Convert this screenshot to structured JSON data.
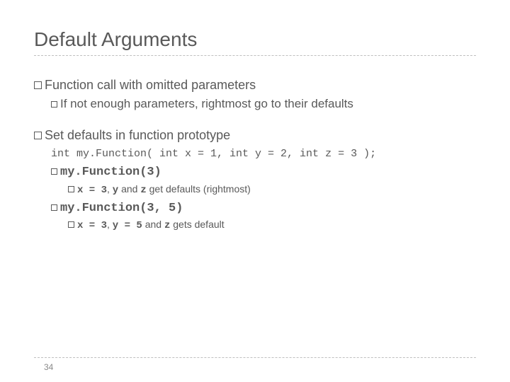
{
  "title": "Default Arguments",
  "bullet1": {
    "text": "Function call with omitted parameters",
    "sub": "If not enough parameters, rightmost go to their defaults"
  },
  "bullet2": {
    "text": "Set defaults in function prototype",
    "code": "int my.Function( int x = 1, int y = 2, int z = 3 );",
    "ex1": {
      "call": "my.Function(3)",
      "expl_pre": "x = 3",
      "expl_mid": ", ",
      "expl_y": "y",
      "expl_and": " and ",
      "expl_z": "z",
      "expl_tail": " get defaults (rightmost)"
    },
    "ex2": {
      "call": "my.Function(3, 5)",
      "expl_pre": "x = 3",
      "expl_mid": ", ",
      "expl_y": "y = 5",
      "expl_and": " and ",
      "expl_z": "z",
      "expl_tail": " gets default"
    }
  },
  "page": "34"
}
